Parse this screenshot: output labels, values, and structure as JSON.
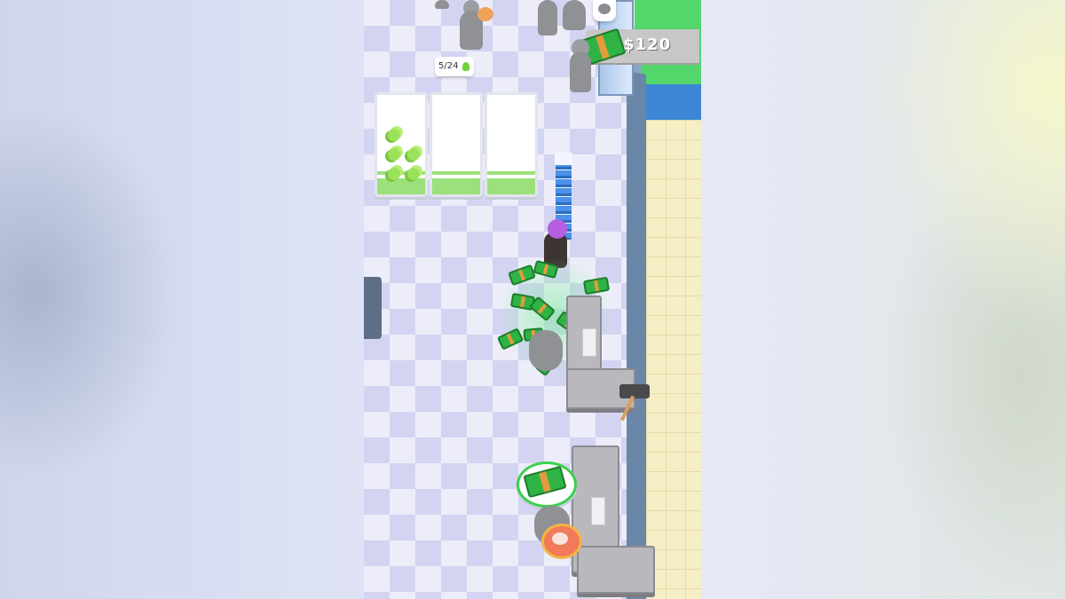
{
  "hud": {
    "cash": "$120",
    "cash_icon": "cash-stack-icon",
    "accent_green": "#2fb344",
    "accent_orange": "#e39b3c"
  },
  "shelf_counter": {
    "text": "5/24",
    "icon": "broccoli-icon"
  },
  "objects": {
    "shelves": [
      "broccoli-shelf",
      "empty-shelf",
      "empty-shelf"
    ],
    "pickup_icon": "cash-stack-icon",
    "order_icon": "meat-steak-icon"
  }
}
